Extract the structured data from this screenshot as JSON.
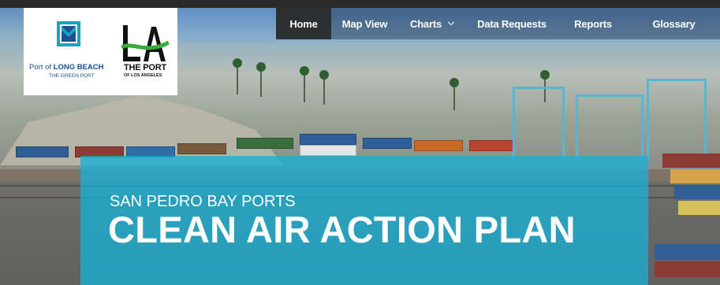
{
  "nav": {
    "items": [
      {
        "label": "Home",
        "active": true
      },
      {
        "label": "Map View",
        "active": false
      },
      {
        "label": "Charts",
        "active": false,
        "has_dropdown": true
      },
      {
        "label": "Data Requests",
        "active": false
      },
      {
        "label": "Reports",
        "active": false
      },
      {
        "label": "Glossary",
        "active": false
      }
    ],
    "active_bg": "#2e2f31"
  },
  "logos": {
    "long_beach": {
      "line1_prefix": "Port of",
      "line1_main": "LONG BEACH",
      "line2": "THE GREEN PORT",
      "color": "#1d4f91",
      "accent": "#1aa3c0"
    },
    "los_angeles": {
      "line1": "THE PORT",
      "line2": "OF LOS ANGELES",
      "accent": "#3aa83a"
    }
  },
  "banner": {
    "subtitle": "SAN PEDRO BAY PORTS",
    "title": "CLEAN AIR ACTION PLAN",
    "color": "#18b0d6"
  },
  "hero_icon": "port-harbor-photo"
}
